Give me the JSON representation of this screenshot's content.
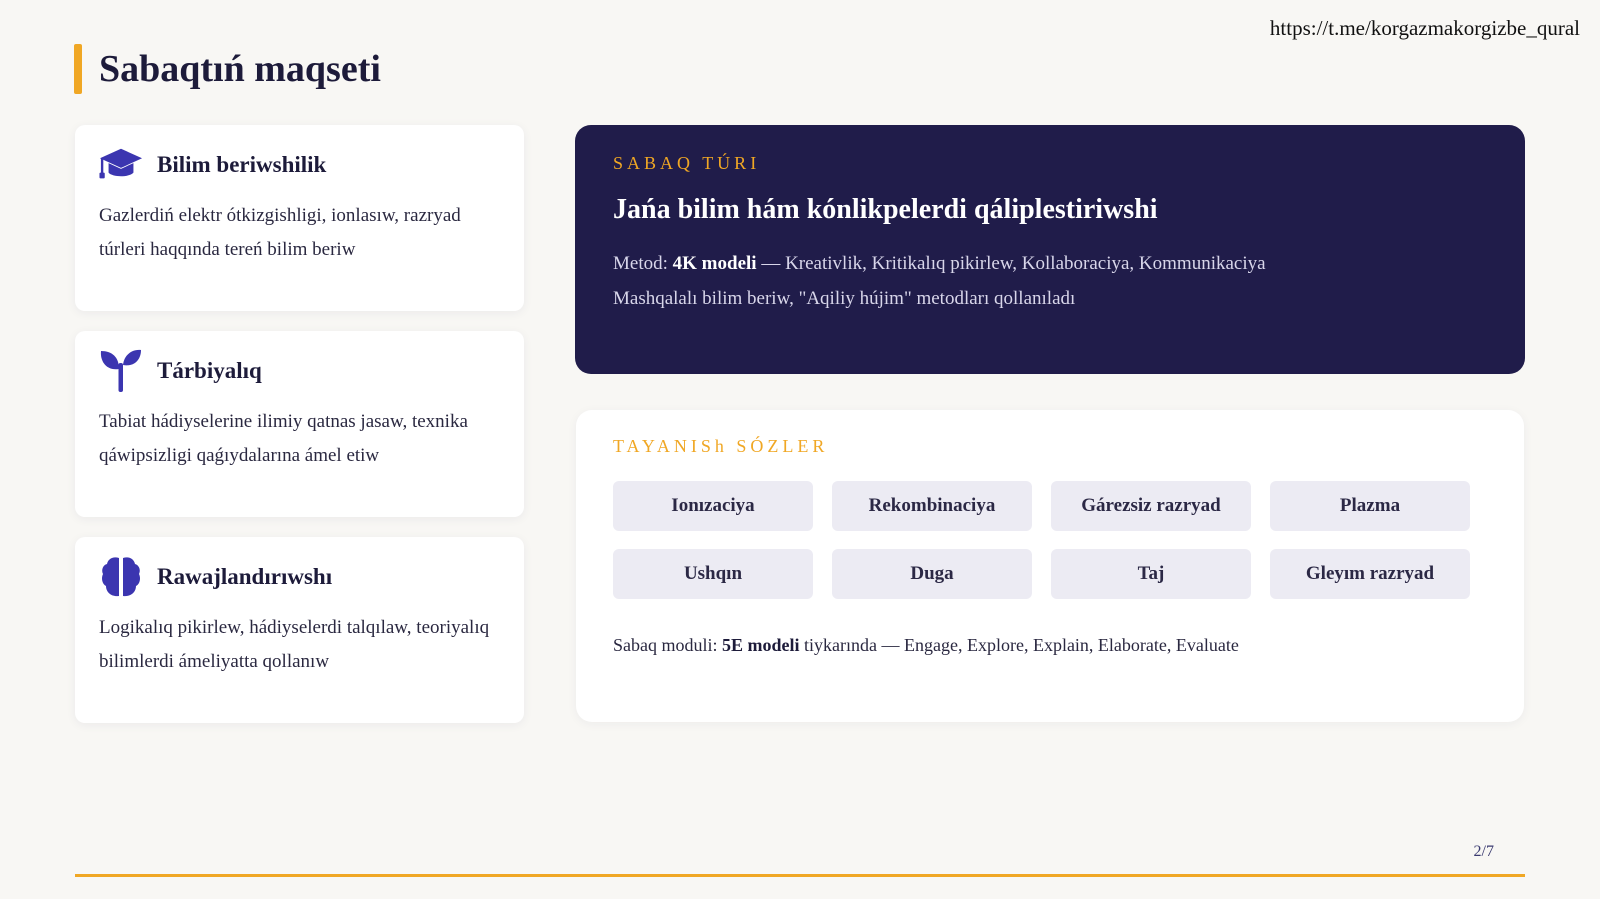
{
  "source_url": "https://t.me/korgazmakorgizbe_qural",
  "page_title": "Sabaqtıń maqseti",
  "cards": [
    {
      "icon": "graduation-cap-icon",
      "title": "Bilim beriwshilik",
      "desc": "Gazlerdiń elektr ótkizgishligi, ionlasıw, razryad túrleri haqqında tereń bilim beriw"
    },
    {
      "icon": "sprout-icon",
      "title": "Tárbiyalıq",
      "desc": "Tabiat hádiyselerine ilimiy qatnas jasaw, texnika qáwipsizligi qaǵıydalarına ámel etiw"
    },
    {
      "icon": "brain-icon",
      "title": "Rawajlandırıwshı",
      "desc": "Logikalıq pikirlew, hádiyselerdi talqılaw, teoriyalıq bilimlerdi ámeliyatta qollanıw"
    }
  ],
  "lesson_type": {
    "label": "SABAQ TÚRI",
    "title": "Jańa bilim hám kónlikpelerdi qáliplestiriwshi",
    "method_prefix": "Metod: ",
    "method_bold": "4K modeli",
    "method_rest": " — Kreativlik, Kritikalıq pikirlew, Kollaboraciya, Kommunikaciya",
    "line2": "Mashqalalı bilim beriw, \"Aqiliy hújim\" metodları qollanıladı"
  },
  "keywords": {
    "label": "TAYANISh SÓZLER",
    "items": [
      "Ionızaciya",
      "Rekombinaciya",
      "Gárezsiz razryad",
      "Plazma",
      "Ushqın",
      "Duga",
      "Taj",
      "Gleyım razryad"
    ],
    "note_prefix": "Sabaq moduli: ",
    "note_bold": "5E modeli",
    "note_rest": " tiykarında — Engage, Explore, Explain, Elaborate, Evaluate"
  },
  "page_number": "2/7",
  "colors": {
    "accent": "#f0a724",
    "dark": "#201c4a",
    "icon": "#3b35b0"
  }
}
